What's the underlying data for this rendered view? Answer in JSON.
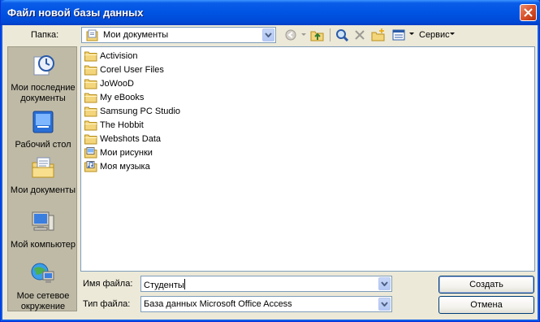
{
  "window": {
    "title": "Файл новой базы данных"
  },
  "look_in": {
    "label": "Папка:",
    "value": "Мои документы",
    "icon": "my-documents-icon"
  },
  "toolbar": {
    "service_label": "Сервис",
    "buttons": [
      "back-icon",
      "up-folder-icon",
      "search-web-icon",
      "delete-icon",
      "new-folder-icon",
      "views-icon"
    ]
  },
  "places": [
    {
      "label": "Мои последние документы",
      "icon": "recent-documents-icon"
    },
    {
      "label": "Рабочий стол",
      "icon": "desktop-icon"
    },
    {
      "label": "Мои документы",
      "icon": "my-documents-icon"
    },
    {
      "label": "Мой компьютер",
      "icon": "my-computer-icon"
    },
    {
      "label": "Мое сетевое окружение",
      "icon": "network-places-icon"
    }
  ],
  "files": [
    {
      "name": "Activision",
      "icon": "folder-icon"
    },
    {
      "name": "Corel User Files",
      "icon": "folder-icon"
    },
    {
      "name": "JoWooD",
      "icon": "folder-icon"
    },
    {
      "name": "My eBooks",
      "icon": "folder-icon"
    },
    {
      "name": "Samsung PC Studio",
      "icon": "folder-icon"
    },
    {
      "name": "The Hobbit",
      "icon": "folder-icon"
    },
    {
      "name": "Webshots Data",
      "icon": "folder-icon"
    },
    {
      "name": "Мои рисунки",
      "icon": "my-pictures-icon"
    },
    {
      "name": "Моя музыка",
      "icon": "my-music-icon"
    }
  ],
  "file_name": {
    "label": "Имя файла:",
    "value": "Студенты"
  },
  "file_type": {
    "label": "Тип файла:",
    "value": "База данных Microsoft Office Access"
  },
  "buttons": {
    "create": "Создать",
    "cancel": "Отмена"
  },
  "colors": {
    "title_bar": "#0054e3",
    "dialog_bg": "#ece9d8",
    "places_bar": "#bfbaa6",
    "close_button": "#d8532c"
  }
}
